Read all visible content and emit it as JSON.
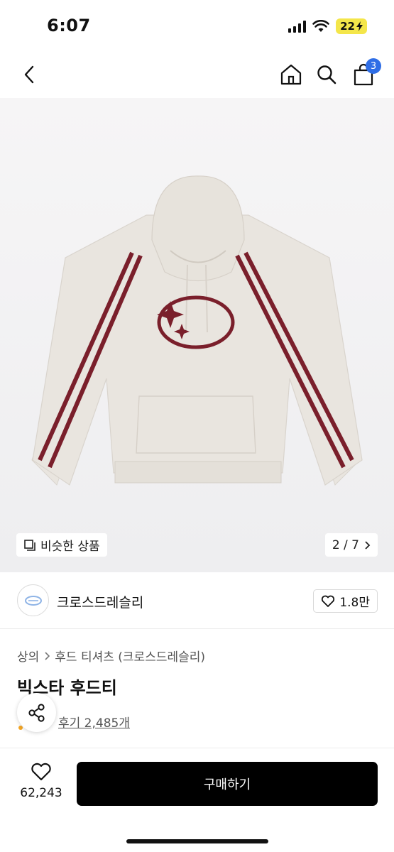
{
  "status": {
    "time": "6:07",
    "battery": "22"
  },
  "nav": {
    "cart_count": "3"
  },
  "gallery": {
    "similar_label": "비슷한 상품",
    "counter": "2 / 7"
  },
  "brand": {
    "name": "크로스드레슬리",
    "likes": "1.8만"
  },
  "breadcrumb": {
    "category": "상의",
    "subcategory": "후드 티셔츠 (크로스드레슬리)"
  },
  "product": {
    "title": "빅스타 후드티",
    "reviews": "후기 2,485개"
  },
  "bottom": {
    "wish_count": "62,243",
    "buy_label": "구매하기"
  },
  "colors": {
    "accent": "#7a1f2b",
    "badge": "#2f6ee6",
    "hoodie": "#e9e5df",
    "buy": "#000000"
  }
}
